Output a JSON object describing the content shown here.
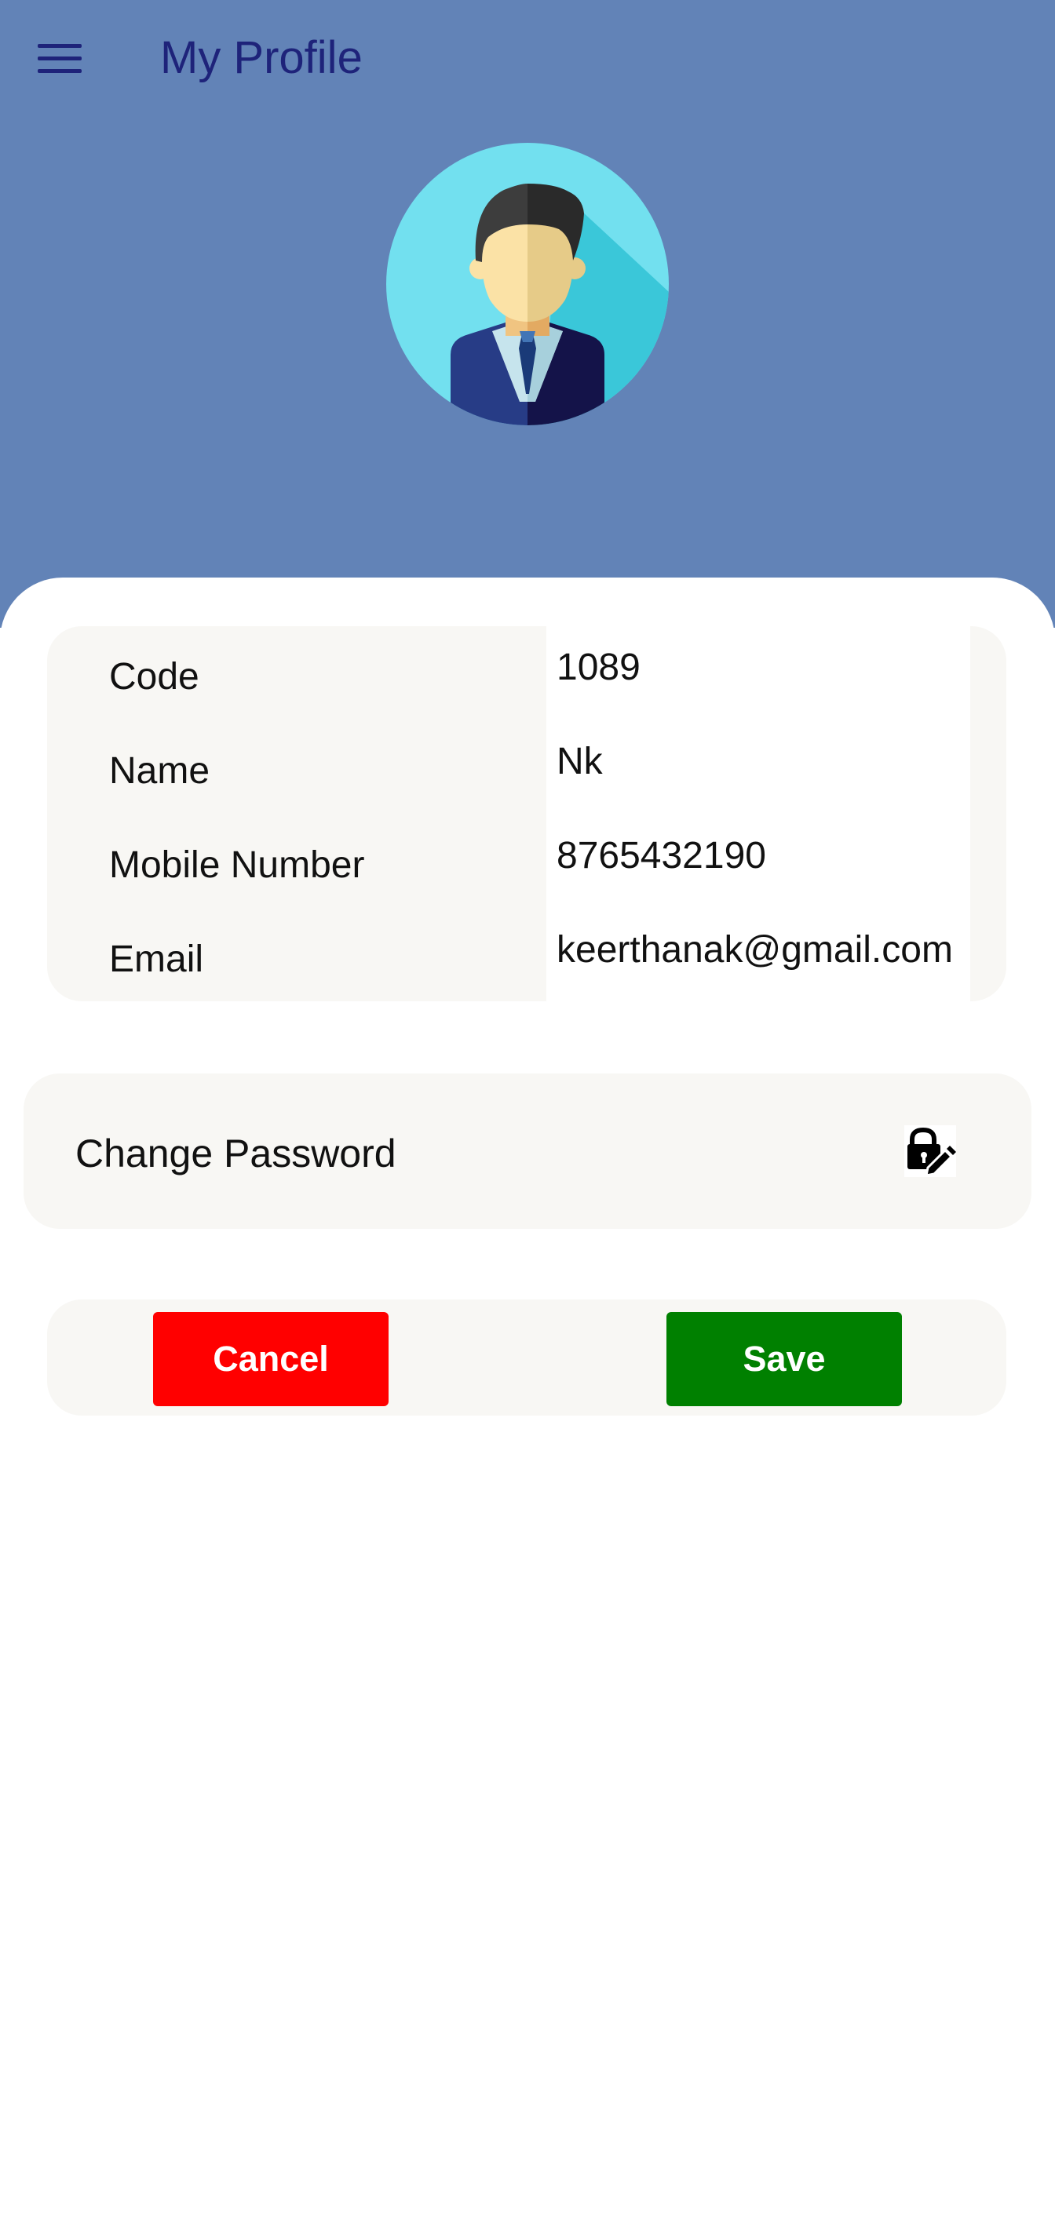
{
  "header": {
    "title": "My Profile",
    "menu_icon": "hamburger-menu-icon",
    "background_color": "#6283b7",
    "title_color": "#1e237a"
  },
  "avatar": {
    "icon": "businessman-avatar-icon"
  },
  "profile": {
    "fields": [
      {
        "label": "Code",
        "value": "1089"
      },
      {
        "label": "Name",
        "value": "Nk"
      },
      {
        "label": "Mobile Number",
        "value": "8765432190"
      },
      {
        "label": "Email",
        "value": "keerthanak@gmail.com"
      }
    ]
  },
  "password": {
    "label": "Change Password",
    "icon": "lock-edit-icon"
  },
  "actions": {
    "cancel_label": "Cancel",
    "save_label": "Save",
    "cancel_color": "#ff0000",
    "save_color": "#008000"
  }
}
